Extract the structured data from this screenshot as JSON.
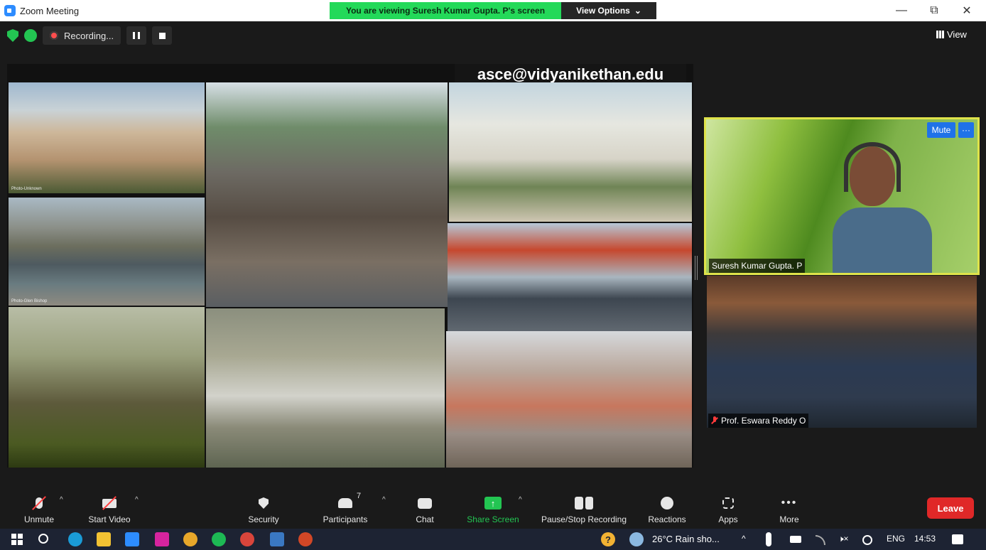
{
  "window": {
    "title": "Zoom Meeting",
    "controls": {
      "minimize": "—",
      "restore": "⧉",
      "close": "✕"
    }
  },
  "banner": {
    "viewing_text": "You are viewing Suresh Kumar Gupta. P's screen",
    "view_options_label": "View Options",
    "view_options_caret": "⌄"
  },
  "meeting_bar": {
    "recording_label": "Recording...",
    "view_label": "View"
  },
  "shared_screen": {
    "email": "asce@vidyanikethan.edu",
    "captions": {
      "photo1": "Photo-Unknown",
      "photo2": "Photo-Glen Bishop"
    }
  },
  "participants_tiles": [
    {
      "name": "Suresh Kumar Gupta. P",
      "muted": false,
      "active_speaker": true
    },
    {
      "name": "Prof. Eswara Reddy O",
      "muted": true,
      "active_speaker": false
    }
  ],
  "tile_controls": {
    "mute_label": "Mute",
    "more_label": "···"
  },
  "toolbar": {
    "unmute": "Unmute",
    "start_video": "Start Video",
    "security": "Security",
    "participants": "Participants",
    "participants_count": "7",
    "chat": "Chat",
    "share_screen": "Share Screen",
    "pause_stop_recording": "Pause/Stop Recording",
    "reactions": "Reactions",
    "apps": "Apps",
    "more": "More",
    "more_dots": "•••",
    "leave": "Leave",
    "caret": "^",
    "share_arrow": "↑"
  },
  "taskbar": {
    "weather": "26°C  Rain sho...",
    "language": "ENG",
    "time": "14:53",
    "tray_up": "^",
    "volume": "🕨×",
    "help": "?"
  },
  "colors": {
    "meeting_bg": "#1a1a1a",
    "banner_green": "#23d959",
    "accent_blue": "#1f72e8",
    "speaker_border": "#dfe34a",
    "leave_red": "#e02828",
    "share_green": "#23c552",
    "taskbar_bg": "#1d2333"
  },
  "icons": [
    "zoom-app-icon",
    "security-shield-icon",
    "encryption-icon",
    "record-dot-icon",
    "pause-icon",
    "stop-icon",
    "grid-view-icon",
    "mic-muted-icon",
    "video-off-icon",
    "shield-icon",
    "participants-icon",
    "chat-bubble-icon",
    "share-screen-icon",
    "record-controls-icon",
    "reactions-icon",
    "apps-icon",
    "more-dots-icon",
    "windows-logo-icon",
    "search-icon",
    "edge-icon",
    "file-explorer-icon",
    "zoom-taskbar-icon",
    "instagram-icon",
    "chrome-icon",
    "spotify-icon",
    "chrome-alt-icon",
    "photos-icon",
    "powerpoint-icon",
    "help-icon",
    "weather-icon",
    "microphone-icon",
    "battery-icon",
    "wifi-icon",
    "volume-icon",
    "pen-icon",
    "notification-icon"
  ]
}
